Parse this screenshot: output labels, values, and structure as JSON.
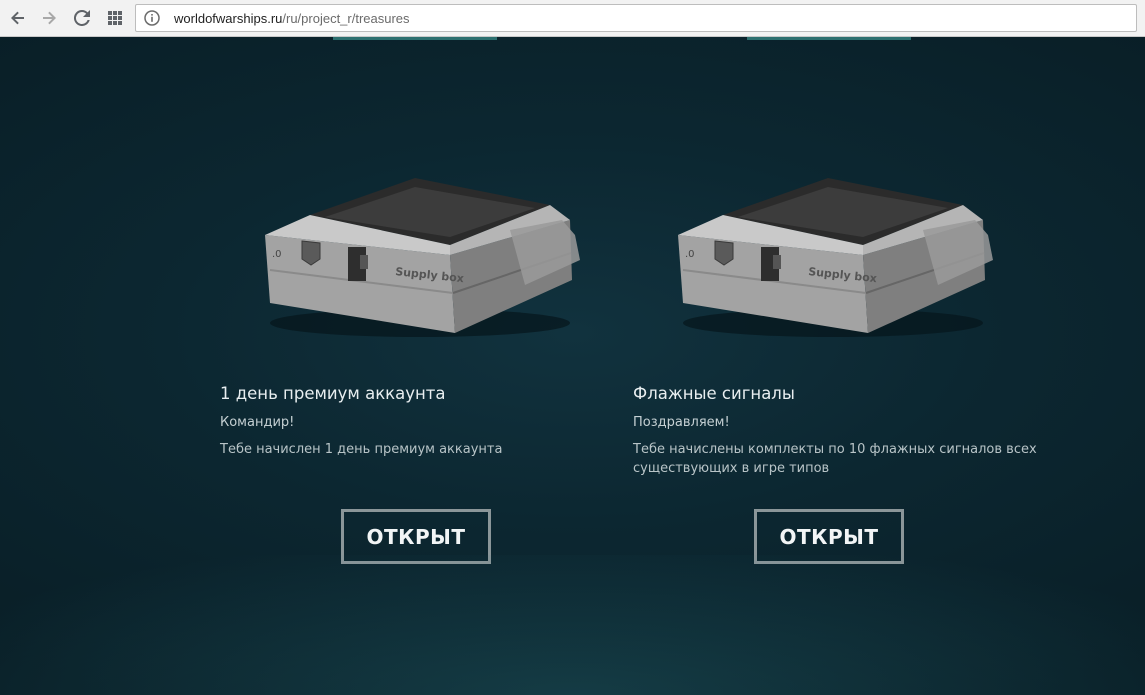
{
  "browser": {
    "url_host": "worldofwarships.ru",
    "url_path": "/ru/project_r/treasures"
  },
  "cards": [
    {
      "title": "1 день премиум аккаунта",
      "greeting": "Командир!",
      "description": "Тебе начислен 1 день премиум аккаунта",
      "button_label": "ОТКРЫТ",
      "box_label": "Supply box"
    },
    {
      "title": "Флажные сигналы",
      "greeting": "Поздравляем!",
      "description": "Тебе начислены комплекты по 10 флажных сигналов всех существующих в игре типов",
      "button_label": "ОТКРЫТ",
      "box_label": "Supply box"
    }
  ],
  "icons": {
    "back": "arrow-left-icon",
    "forward": "arrow-right-icon",
    "reload": "reload-icon",
    "apps": "apps-grid-icon",
    "site_info": "info-icon"
  }
}
